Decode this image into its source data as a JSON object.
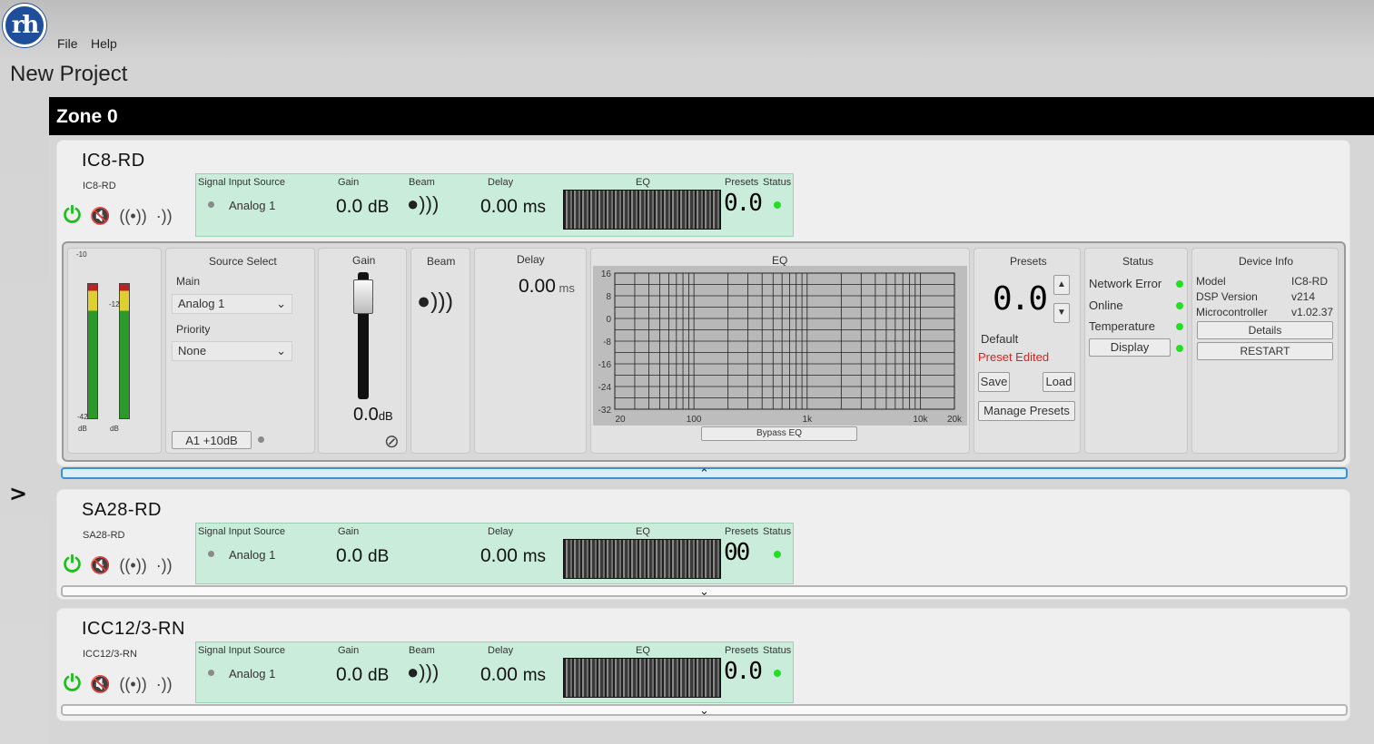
{
  "app": {
    "logo_text": "rh",
    "menu": [
      "File",
      "Help"
    ],
    "project_title": "New Project"
  },
  "zone": {
    "title": "Zone 0"
  },
  "labels": {
    "signal_input_source": "Signal Input Source",
    "gain": "Gain",
    "beam": "Beam",
    "delay": "Delay",
    "eq": "EQ",
    "presets": "Presets",
    "status": "Status"
  },
  "devices": [
    {
      "name": "IC8-RD",
      "sub": "IC8-RD",
      "input": "Analog 1",
      "gain": "0.0",
      "gain_unit": "dB",
      "delay": "0.00",
      "delay_unit": "ms",
      "preset_display": "0.0"
    },
    {
      "name": "SA28-RD",
      "sub": "SA28-RD",
      "input": "Analog 1",
      "gain": "0.0",
      "gain_unit": "dB",
      "delay": "0.00",
      "delay_unit": "ms",
      "preset_display": "00"
    },
    {
      "name": "ICC12/3-RN",
      "sub": "ICC12/3-RN",
      "input": "Analog 1",
      "gain": "0.0",
      "gain_unit": "dB",
      "delay": "0.00",
      "delay_unit": "ms",
      "preset_display": "0.0"
    }
  ],
  "expanded": {
    "meters": {
      "top_label": "-10",
      "mid_label": "-12",
      "bottom_label": "-42",
      "bottom_unit": "dB",
      "left_level": 0.82,
      "right_level": 0.82
    },
    "source_select": {
      "title": "Source Select",
      "main_label": "Main",
      "main_value": "Analog 1",
      "priority_label": "Priority",
      "priority_value": "None",
      "a1_button": "A1 +10dB"
    },
    "gain": {
      "title": "Gain",
      "value": "0.0",
      "unit": "dB",
      "fader_level": 0.92
    },
    "beam": {
      "title": "Beam"
    },
    "delay": {
      "title": "Delay",
      "value": "0.00",
      "unit": "ms"
    },
    "eq": {
      "title": "EQ",
      "y_ticks": [
        "16",
        "8",
        "0",
        "-8",
        "-16",
        "-24",
        "-32"
      ],
      "x_ticks": [
        "20",
        "100",
        "1k",
        "10k",
        "20k"
      ],
      "bypass": "Bypass EQ"
    },
    "presets": {
      "title": "Presets",
      "display": "0.0",
      "name": "Default",
      "edited": "Preset Edited",
      "save": "Save",
      "load": "Load",
      "manage": "Manage Presets"
    },
    "status": {
      "title": "Status",
      "items": [
        "Network Error",
        "Online",
        "Temperature"
      ],
      "display_button": "Display"
    },
    "device_info": {
      "title": "Device Info",
      "model_label": "Model",
      "model": "IC8-RD",
      "dsp_label": "DSP Version",
      "dsp": "v214",
      "micro_label": "Microcontroller",
      "micro": "v1.02.37",
      "details": "Details",
      "restart": "RESTART"
    }
  },
  "colors": {
    "status_green": "#24e024",
    "power_green": "#1bbf1b",
    "panel_green": "#c9edda",
    "preset_edited": "#e0201a"
  }
}
